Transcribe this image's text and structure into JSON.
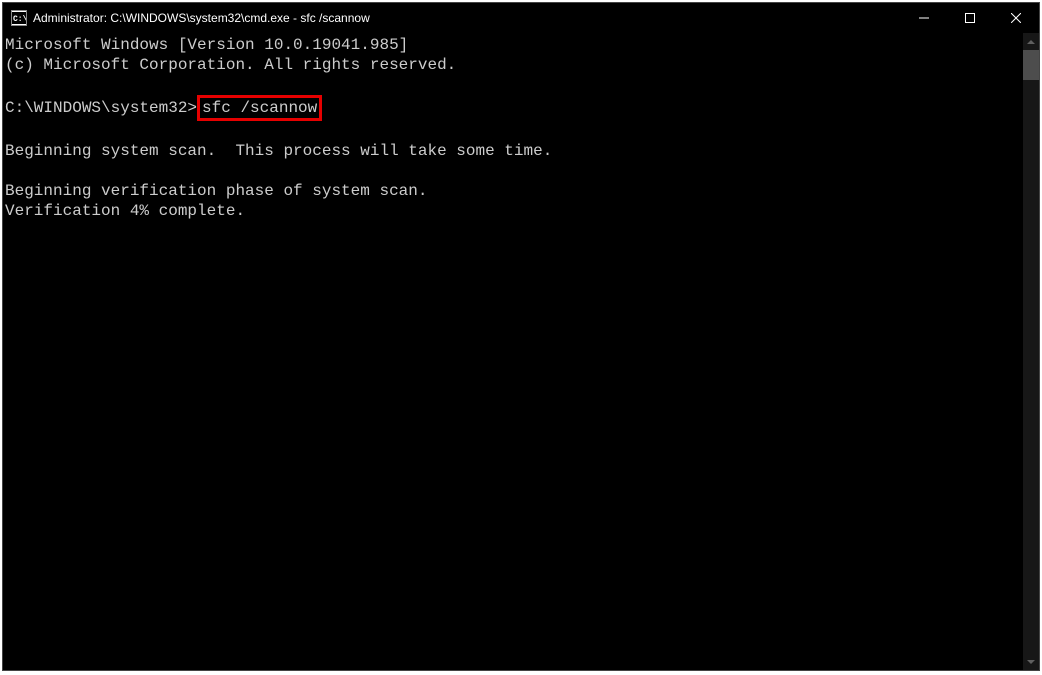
{
  "titlebar": {
    "icon_label": "C:\\",
    "title": "Administrator: C:\\WINDOWS\\system32\\cmd.exe - sfc  /scannow"
  },
  "terminal": {
    "line1": "Microsoft Windows [Version 10.0.19041.985]",
    "line2": "(c) Microsoft Corporation. All rights reserved.",
    "blank1": "",
    "prompt": "C:\\WINDOWS\\system32>",
    "command": "sfc /scannow",
    "blank2": "",
    "line3": "Beginning system scan.  This process will take some time.",
    "blank3": "",
    "line4": "Beginning verification phase of system scan.",
    "line5": "Verification 4% complete."
  }
}
